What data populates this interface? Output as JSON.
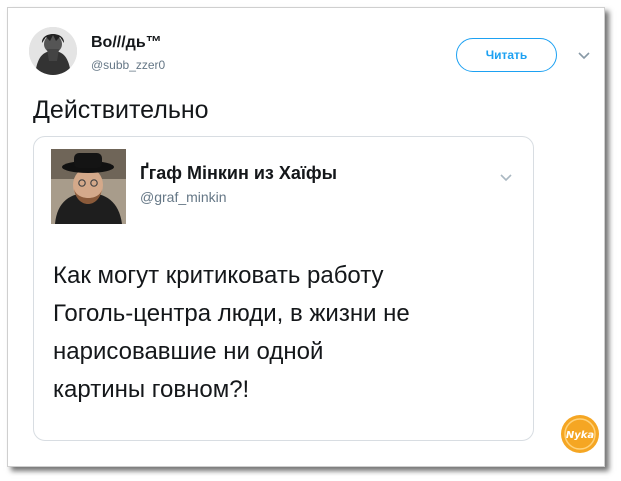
{
  "tweet": {
    "author_name": "Bo///дь™",
    "author_handle": "@subb_zzer0",
    "follow_label": "Читать",
    "text": "Действительно"
  },
  "quoted_tweet": {
    "author_name": "Ґгаф Мінкин из Хаїфы",
    "author_handle": "@graf_minkin",
    "lines": [
      "Как могут критиковать работу",
      "Гоголь-центра люди, в жизни не",
      "нарисовавшие ни одной",
      "картины говном?!"
    ]
  },
  "watermark": {
    "text": "Nyka"
  },
  "colors": {
    "accent": "#1da1f2",
    "text": "#14171a",
    "secondary": "#657786",
    "border": "#d8dde2",
    "badge": "#f5a623"
  },
  "icons": [
    "chevron-down-icon",
    "chevron-down-icon"
  ]
}
